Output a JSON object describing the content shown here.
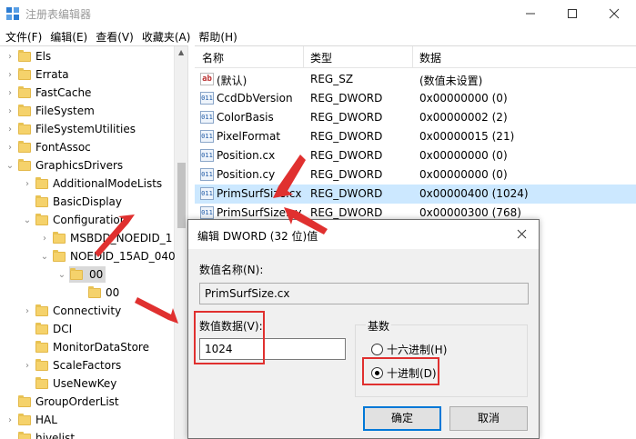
{
  "window": {
    "title": "注册表编辑器",
    "controls": {
      "minimize": "—",
      "maximize": "☐",
      "close": "✕"
    }
  },
  "menu": [
    "文件(F)",
    "编辑(E)",
    "查看(V)",
    "收藏夹(A)",
    "帮助(H)"
  ],
  "tree": {
    "nodes": [
      {
        "label": "Els",
        "expander": ">",
        "level": 0
      },
      {
        "label": "Errata",
        "expander": ">",
        "level": 0
      },
      {
        "label": "FastCache",
        "expander": ">",
        "level": 0
      },
      {
        "label": "FileSystem",
        "expander": ">",
        "level": 0
      },
      {
        "label": "FileSystemUtilities",
        "expander": ">",
        "level": 0
      },
      {
        "label": "FontAssoc",
        "expander": ">",
        "level": 0
      },
      {
        "label": "GraphicsDrivers",
        "expander": "v",
        "level": 0
      },
      {
        "label": "AdditionalModeLists",
        "expander": ">",
        "level": 1
      },
      {
        "label": "BasicDisplay",
        "expander": "",
        "level": 1
      },
      {
        "label": "Configuration",
        "expander": "v",
        "level": 1
      },
      {
        "label": "MSBDD_NOEDID_1",
        "expander": ">",
        "level": 2
      },
      {
        "label": "NOEDID_15AD_040",
        "expander": "v",
        "level": 2
      },
      {
        "label": "00",
        "expander": "v",
        "level": 3,
        "selected": true
      },
      {
        "label": "00",
        "expander": "",
        "level": 4
      },
      {
        "label": "Connectivity",
        "expander": ">",
        "level": 1
      },
      {
        "label": "DCI",
        "expander": "",
        "level": 1
      },
      {
        "label": "MonitorDataStore",
        "expander": "",
        "level": 1
      },
      {
        "label": "ScaleFactors",
        "expander": ">",
        "level": 1
      },
      {
        "label": "UseNewKey",
        "expander": "",
        "level": 1
      },
      {
        "label": "GroupOrderList",
        "expander": "",
        "level": 0
      },
      {
        "label": "HAL",
        "expander": ">",
        "level": 0
      },
      {
        "label": "hivelist",
        "expander": "",
        "level": 0
      }
    ]
  },
  "list": {
    "headers": {
      "name": "名称",
      "type": "类型",
      "data": "数据"
    },
    "rows": [
      {
        "icon": "ab",
        "name": "(默认)",
        "type": "REG_SZ",
        "data": "(数值未设置)"
      },
      {
        "icon": "011",
        "name": "CcdDbVersion",
        "type": "REG_DWORD",
        "data": "0x00000000 (0)"
      },
      {
        "icon": "011",
        "name": "ColorBasis",
        "type": "REG_DWORD",
        "data": "0x00000002 (2)"
      },
      {
        "icon": "011",
        "name": "PixelFormat",
        "type": "REG_DWORD",
        "data": "0x00000015 (21)"
      },
      {
        "icon": "011",
        "name": "Position.cx",
        "type": "REG_DWORD",
        "data": "0x00000000 (0)"
      },
      {
        "icon": "011",
        "name": "Position.cy",
        "type": "REG_DWORD",
        "data": "0x00000000 (0)"
      },
      {
        "icon": "011",
        "name": "PrimSurfSize.cx",
        "type": "REG_DWORD",
        "data": "0x00000400 (1024)",
        "selected": true
      },
      {
        "icon": "011",
        "name": "PrimSurfSize.cy",
        "type": "REG_DWORD",
        "data": "0x00000300 (768)"
      }
    ]
  },
  "dialog": {
    "title": "编辑 DWORD (32 位)值",
    "value_name_label": "数值名称(N):",
    "value_name": "PrimSurfSize.cx",
    "value_data_label": "数值数据(V):",
    "value_data": "1024",
    "base_label": "基数",
    "hex_label": "十六进制(H)",
    "dec_label": "十进制(D)",
    "selected_base": "decimal",
    "ok_label": "确定",
    "cancel_label": "取消"
  },
  "colors": {
    "annotation_red": "#e0302f",
    "selection_blue": "#cce8ff",
    "button_focus": "#0078d7",
    "folder_yellow": "#f5d26b"
  }
}
